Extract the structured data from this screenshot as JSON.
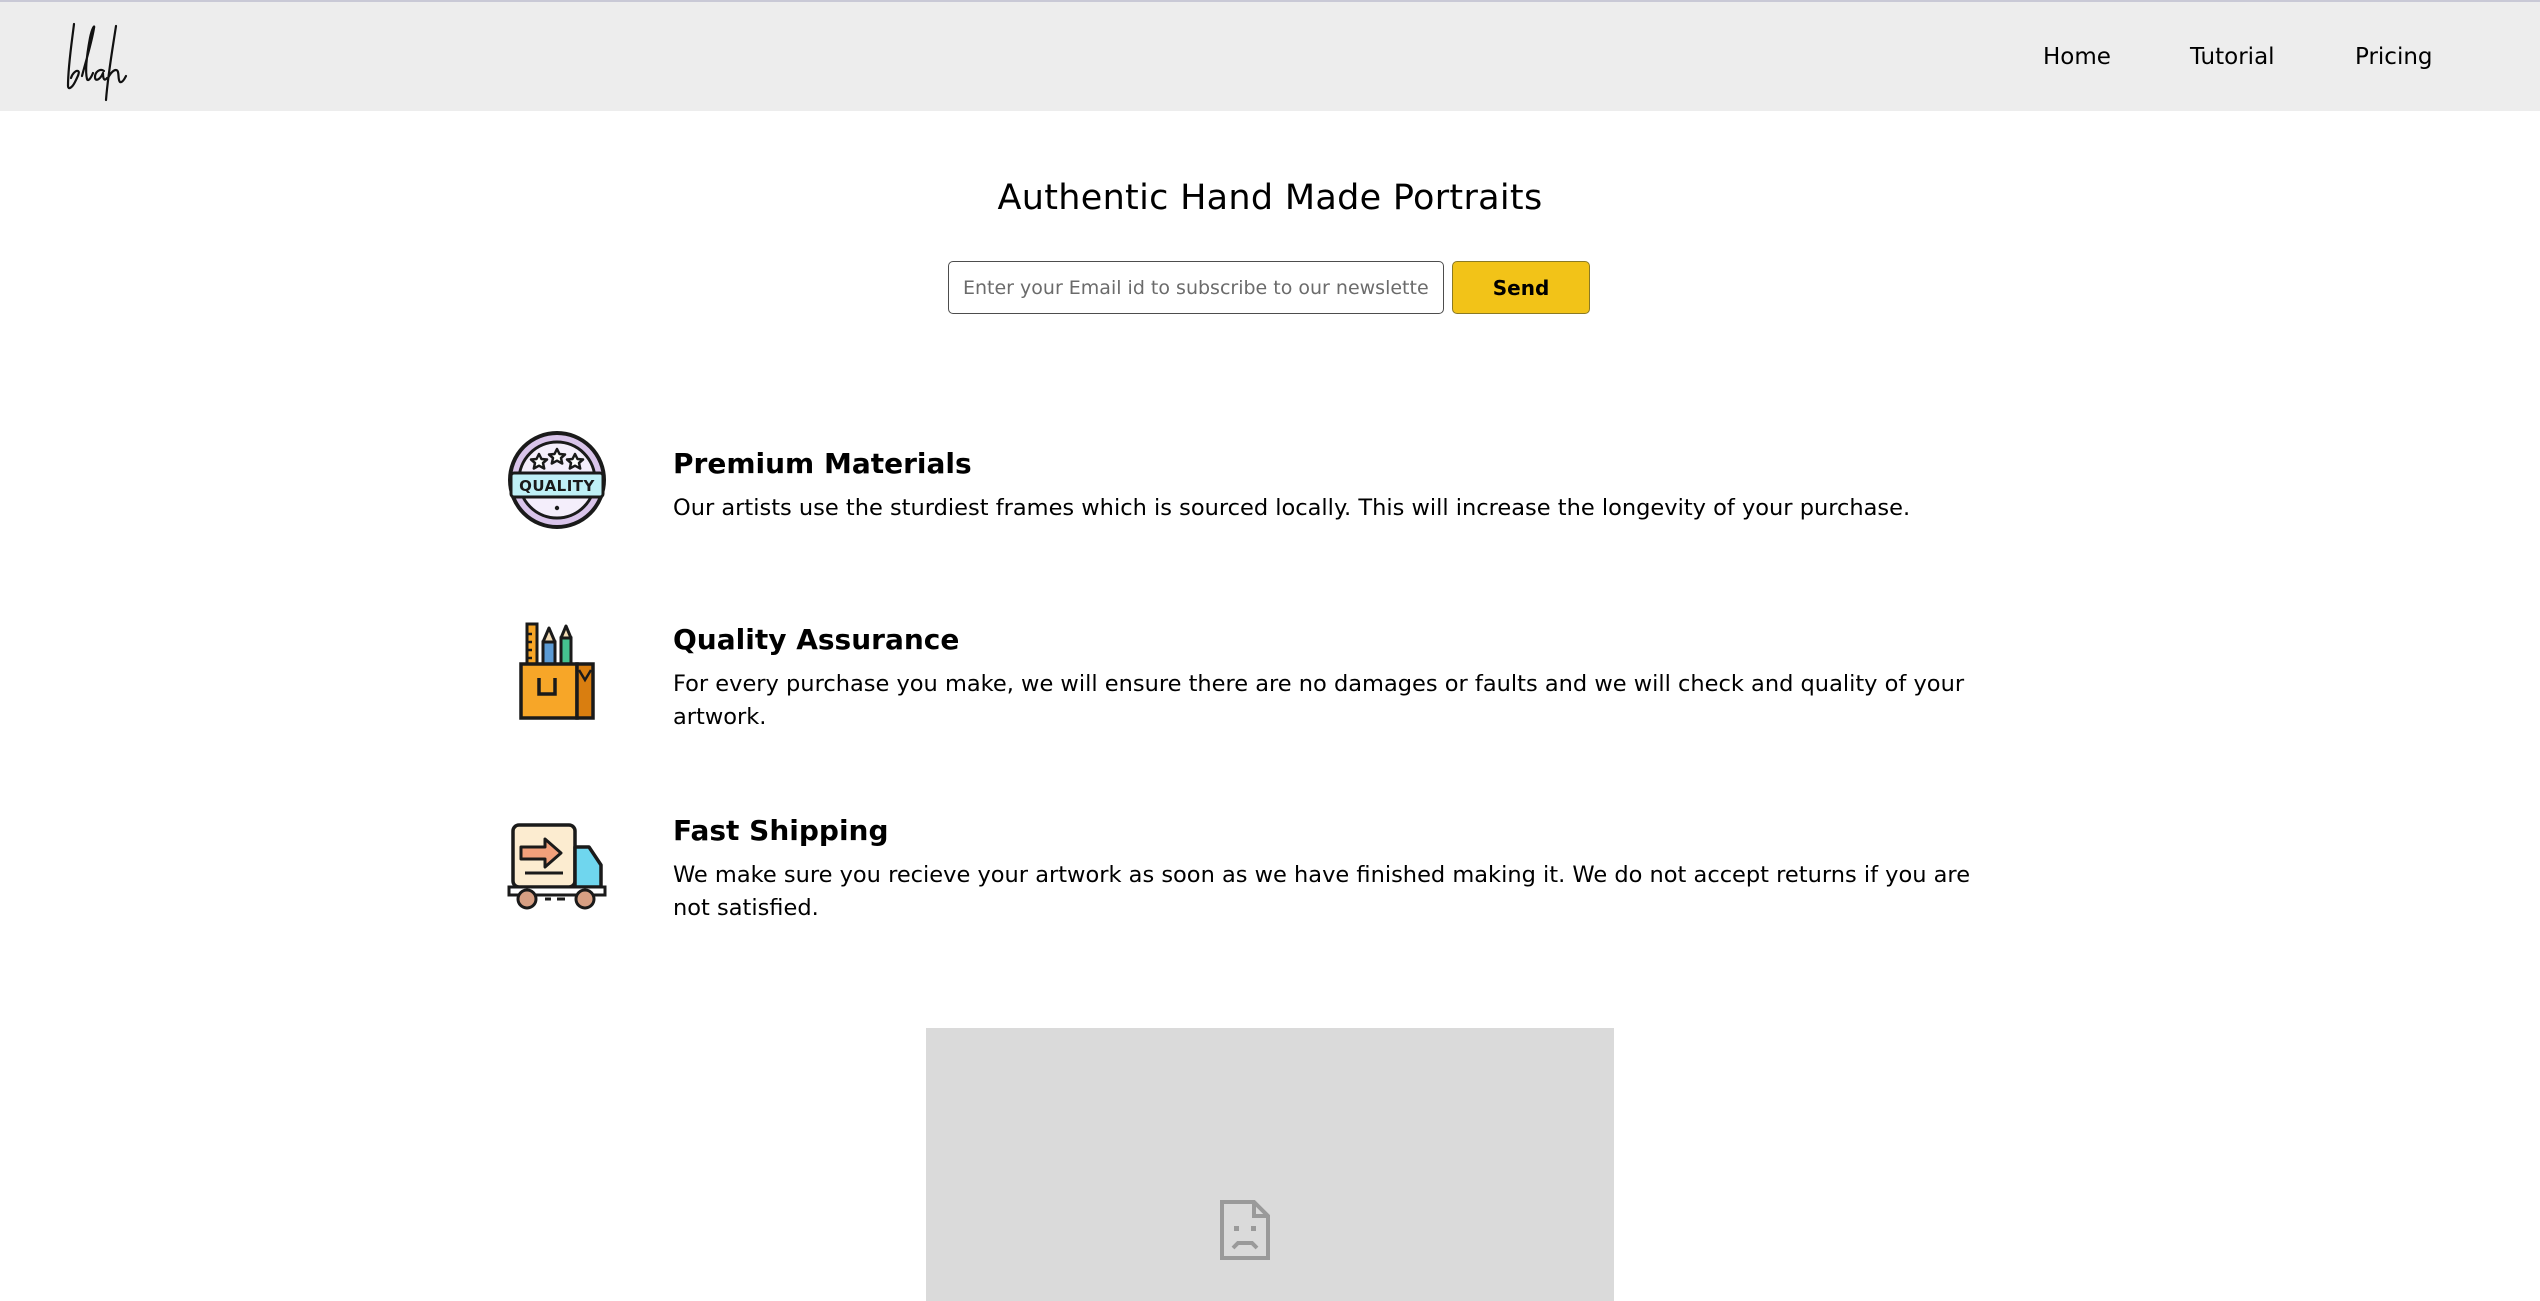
{
  "header": {
    "logo_text": "blah",
    "nav": {
      "home": "Home",
      "tutorial": "Tutorial",
      "pricing": "Pricing"
    }
  },
  "hero": {
    "title": "Authentic Hand Made Portraits",
    "email_placeholder": "Enter your Email id to subscribe to our newsletter",
    "send_label": "Send"
  },
  "features": [
    {
      "icon": "quality-badge-icon",
      "badge_text": "QUALITY",
      "title": "Premium Materials",
      "description": "Our artists use the sturdiest frames which is sourced locally. This will increase the longevity of your purchase."
    },
    {
      "icon": "art-supplies-icon",
      "title": "Quality Assurance",
      "description": "For every purchase you make, we will ensure there are no damages or faults and we will check and quality of your artwork."
    },
    {
      "icon": "delivery-truck-icon",
      "title": "Fast Shipping",
      "description": "We make sure you recieve your artwork as soon as we have finished making it. We do not accept returns if you are not satisfied."
    }
  ],
  "media": {
    "icon": "broken-image-icon"
  },
  "colors": {
    "header_bg": "#ededed",
    "send_button": "#f2c318",
    "media_placeholder": "#dadada"
  }
}
